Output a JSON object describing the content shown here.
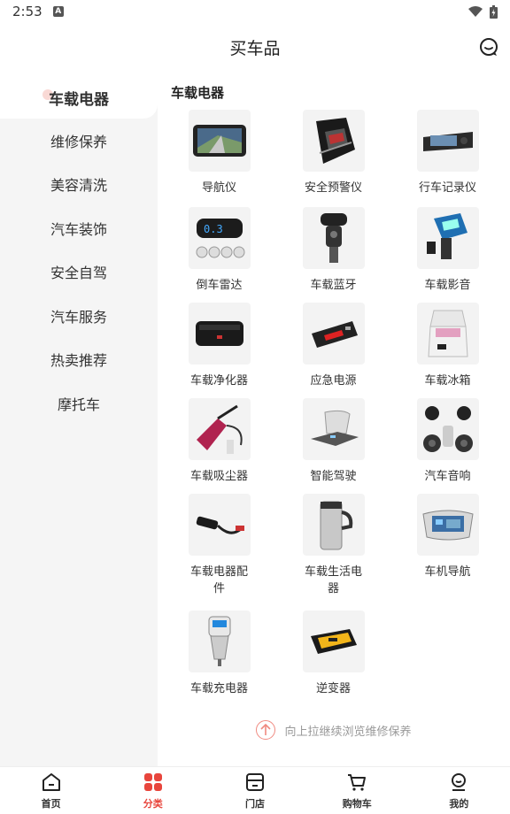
{
  "status": {
    "time": "2:53",
    "notification_icon": "A"
  },
  "header": {
    "title": "买车品",
    "service_icon": "customer-service-icon"
  },
  "sidebar": {
    "items": [
      {
        "label": "车载电器",
        "active": true
      },
      {
        "label": "维修保养"
      },
      {
        "label": "美容清洗"
      },
      {
        "label": "汽车装饰"
      },
      {
        "label": "安全自驾"
      },
      {
        "label": "汽车服务"
      },
      {
        "label": "热卖推荐"
      },
      {
        "label": "摩托车"
      }
    ]
  },
  "content": {
    "section_title": "车载电器",
    "products": [
      {
        "label": "导航仪",
        "icon": "gps-navigator-icon"
      },
      {
        "label": "安全预警仪",
        "icon": "radar-detector-icon"
      },
      {
        "label": "行车记录仪",
        "icon": "dashcam-icon"
      },
      {
        "label": "倒车雷达",
        "icon": "parking-sensor-icon"
      },
      {
        "label": "车载蓝牙",
        "icon": "bluetooth-adapter-icon"
      },
      {
        "label": "车载影音",
        "icon": "fm-transmitter-icon"
      },
      {
        "label": "车载净化器",
        "icon": "air-purifier-icon"
      },
      {
        "label": "应急电源",
        "icon": "jump-starter-icon"
      },
      {
        "label": "车载冰箱",
        "icon": "car-fridge-icon"
      },
      {
        "label": "车载吸尘器",
        "icon": "vacuum-cleaner-icon"
      },
      {
        "label": "智能驾驶",
        "icon": "hud-display-icon"
      },
      {
        "label": "汽车音响",
        "icon": "car-speakers-icon"
      },
      {
        "label": "车载电器配件",
        "icon": "charger-cable-icon"
      },
      {
        "label": "车载生活电器",
        "icon": "heated-mug-icon"
      },
      {
        "label": "车机导航",
        "icon": "head-unit-icon"
      },
      {
        "label": "车载充电器",
        "icon": "car-charger-icon"
      },
      {
        "label": "逆变器",
        "icon": "power-inverter-icon"
      }
    ],
    "pull_hint": "向上拉继续浏览维修保养"
  },
  "tabbar": {
    "items": [
      {
        "label": "首页",
        "icon": "home-icon"
      },
      {
        "label": "分类",
        "icon": "category-icon",
        "active": true
      },
      {
        "label": "门店",
        "icon": "store-icon"
      },
      {
        "label": "购物车",
        "icon": "cart-icon"
      },
      {
        "label": "我的",
        "icon": "profile-icon"
      }
    ]
  },
  "colors": {
    "accent": "#e8453c",
    "sidebar_bg": "#f5f5f5"
  }
}
